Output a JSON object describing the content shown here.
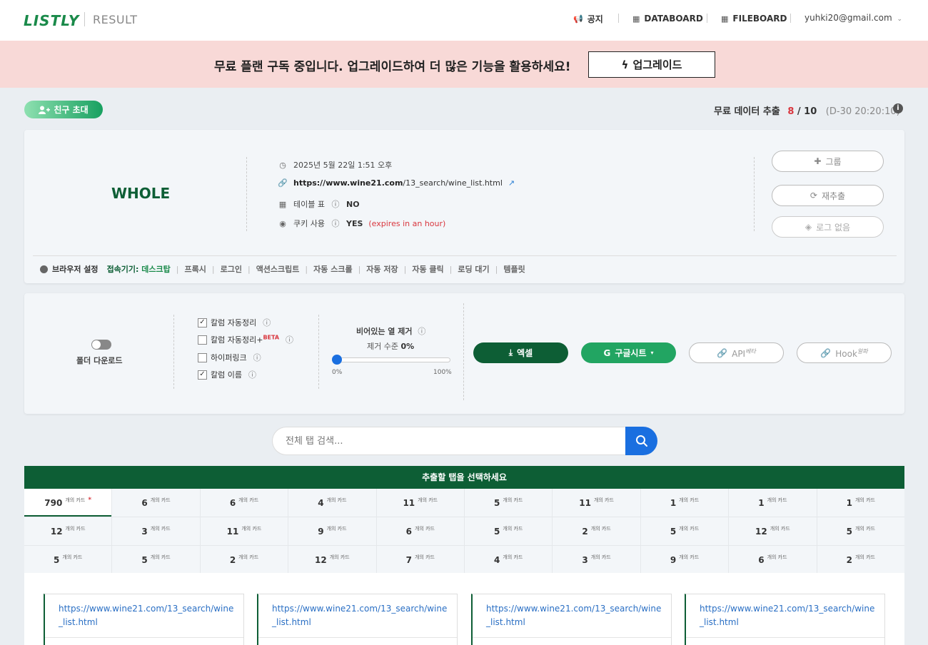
{
  "header": {
    "logo": "LISTLY",
    "section": "RESULT",
    "nav": [
      {
        "label": "공지",
        "icon": "megaphone-icon"
      },
      {
        "label": "DATABOARD",
        "icon": "grid-icon"
      },
      {
        "label": "FILEBOARD",
        "icon": "grid-icon"
      }
    ],
    "user": "yuhki20@gmail.com"
  },
  "banner": {
    "text": "무료 플랜 구독 중입니다. 업그레이드하여 더 많은 기능을 활용하세요!",
    "button": "업그레이드"
  },
  "invite": {
    "label": "친구 초대"
  },
  "quota": {
    "label": "무료 데이터 추출",
    "used": "8",
    "total": "10",
    "dday": "(D-30 20:20:10)"
  },
  "extraction": {
    "mode": "WHOLE",
    "datetime": "2025년 5월 22일 1:51 오후",
    "url_domain": "https://www.wine21.com",
    "url_path": "/13_search/wine_list.html",
    "table_label": "테이블 표",
    "table_value": "NO",
    "cookie_label": "쿠키 사용",
    "cookie_value": "YES",
    "cookie_note": "(expires in an hour)",
    "buttons": {
      "group": "그룹",
      "reextract": "재추출",
      "nolog": "로그 없음"
    }
  },
  "browser_opts": {
    "title": "브라우저 설정",
    "device_label": "접속기기:",
    "device_value": "데스크탑",
    "items": [
      "프록시",
      "로그인",
      "액션스크립트",
      "자동 스크롤",
      "자동 저장",
      "자동 클릭",
      "로딩 대기",
      "템플릿"
    ]
  },
  "download": {
    "folder_label": "폴더 다운로드",
    "checks": [
      {
        "label": "칼럼 자동정리",
        "checked": true
      },
      {
        "label": "칼럼 자동정리+",
        "checked": false,
        "badge": "BETA"
      },
      {
        "label": "하이퍼링크",
        "checked": false
      },
      {
        "label": "칼럼 이름",
        "checked": true
      }
    ],
    "empty_col_title": "비어있는 열 제거",
    "empty_col_level_label": "제거 수준",
    "empty_col_level_value": "0%",
    "slider_min": "0%",
    "slider_max": "100%",
    "excel": "엑셀",
    "gsheet": "구글시트",
    "api": "API",
    "api_sup": "베타",
    "hook": "Hook",
    "hook_sup": "알파"
  },
  "search": {
    "placeholder": "전체 탭 검색..."
  },
  "tabs": {
    "title": "추출할 탭을 선택하세요",
    "unit": "개의 카드",
    "counts": [
      "790",
      "6",
      "6",
      "4",
      "11",
      "5",
      "11",
      "1",
      "1",
      "1",
      "12",
      "3",
      "11",
      "9",
      "6",
      "5",
      "2",
      "5",
      "12",
      "5",
      "5",
      "5",
      "2",
      "12",
      "7",
      "4",
      "3",
      "9",
      "6",
      "2"
    ]
  },
  "cards": [
    {
      "url": "https://www.wine21.com/13_search/wine_list.html"
    },
    {
      "url": "https://www.wine21.com/13_search/wine_list.html"
    },
    {
      "url": "https://www.wine21.com/13_search/wine_list.html"
    },
    {
      "url": "https://www.wine21.com/13_search/wine_list.html"
    }
  ],
  "colors": {
    "brand_green": "#0d5e35",
    "accent_blue": "#1a6fe0",
    "alert_red": "#d9363e",
    "banner_bg": "#f8d9d7"
  }
}
